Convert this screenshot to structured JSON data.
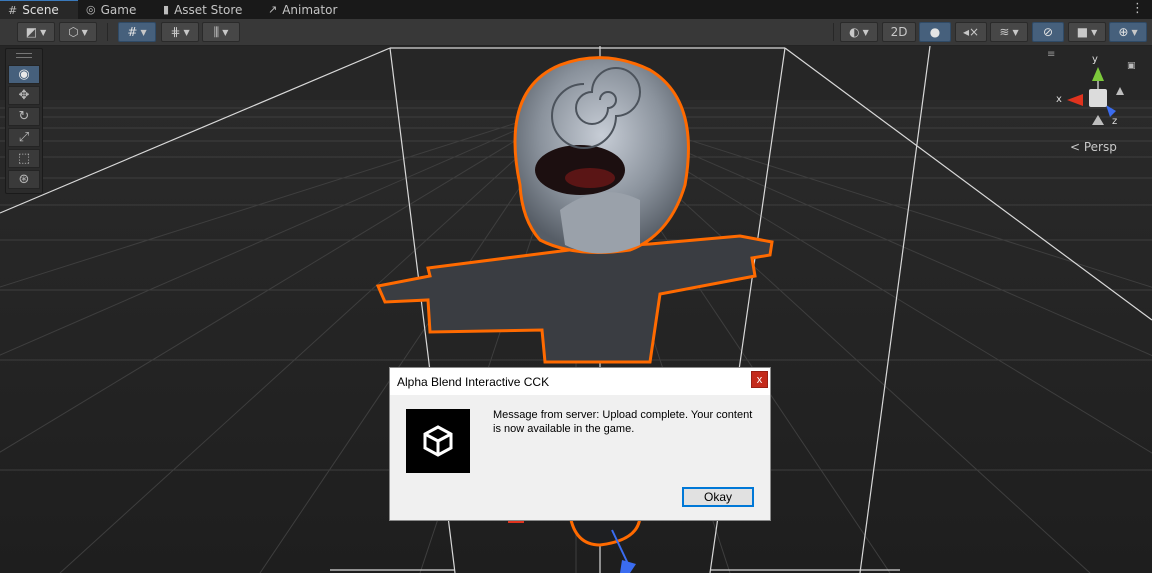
{
  "tabs": [
    {
      "label": "Scene",
      "icon": "grid-icon"
    },
    {
      "label": "Game",
      "icon": "gamepad-icon"
    },
    {
      "label": "Asset Store",
      "icon": "shopping-bag-icon"
    },
    {
      "label": "Animator",
      "icon": "animator-icon"
    }
  ],
  "toolbar": {
    "mode_2d_label": "2D",
    "left_buttons": [
      "draw-mode",
      "shading",
      "grid-snap",
      "increment-snap",
      "snap-settings"
    ],
    "right_buttons": [
      "render-mode",
      "2d",
      "lighting",
      "audio",
      "effects",
      "scene-visibility",
      "camera",
      "gizmos"
    ]
  },
  "tools": [
    "view",
    "move",
    "rotate",
    "scale",
    "rect",
    "transform"
  ],
  "gizmo": {
    "x": "x",
    "y": "y",
    "z": "z",
    "projection": "< Persp"
  },
  "dialog": {
    "title": "Alpha Blend Interactive CCK",
    "close": "x",
    "message": "Message from server: Upload complete. Your content is now available in the game.",
    "ok": "Okay"
  },
  "colors": {
    "accent": "#46607c",
    "outline": "#ff6a00",
    "axis_x": "#e0331e",
    "axis_y": "#7cc93b",
    "axis_z": "#3a6cf0",
    "close": "#c42b1c"
  }
}
